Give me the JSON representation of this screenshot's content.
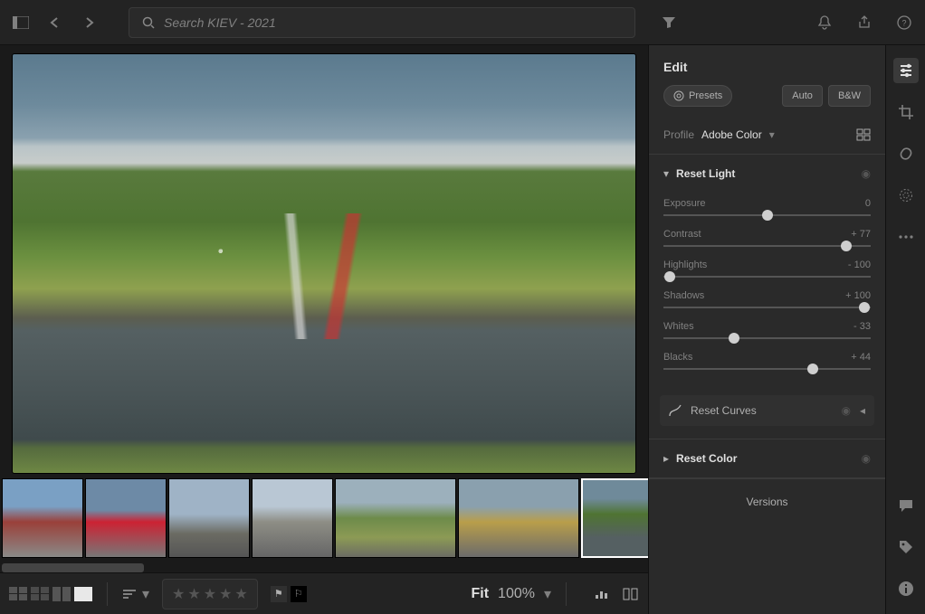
{
  "search": {
    "placeholder": "Search KIEV - 2021"
  },
  "edit": {
    "title": "Edit",
    "presets": "Presets",
    "auto": "Auto",
    "bw": "B&W",
    "profile_label": "Profile",
    "profile_value": "Adobe Color",
    "light_title": "Reset Light",
    "color_title": "Reset Color",
    "curves_title": "Reset Curves"
  },
  "sliders": {
    "exposure": {
      "label": "Exposure",
      "value": "0",
      "pos": 50
    },
    "contrast": {
      "label": "Contrast",
      "value": "+ 77",
      "pos": 88
    },
    "highlights": {
      "label": "Highlights",
      "value": "- 100",
      "pos": 3
    },
    "shadows": {
      "label": "Shadows",
      "value": "+ 100",
      "pos": 97
    },
    "whites": {
      "label": "Whites",
      "value": "- 33",
      "pos": 34
    },
    "blacks": {
      "label": "Blacks",
      "value": "+ 44",
      "pos": 72
    }
  },
  "bottom": {
    "fit": "Fit",
    "zoom": "100%"
  },
  "versions": "Versions"
}
